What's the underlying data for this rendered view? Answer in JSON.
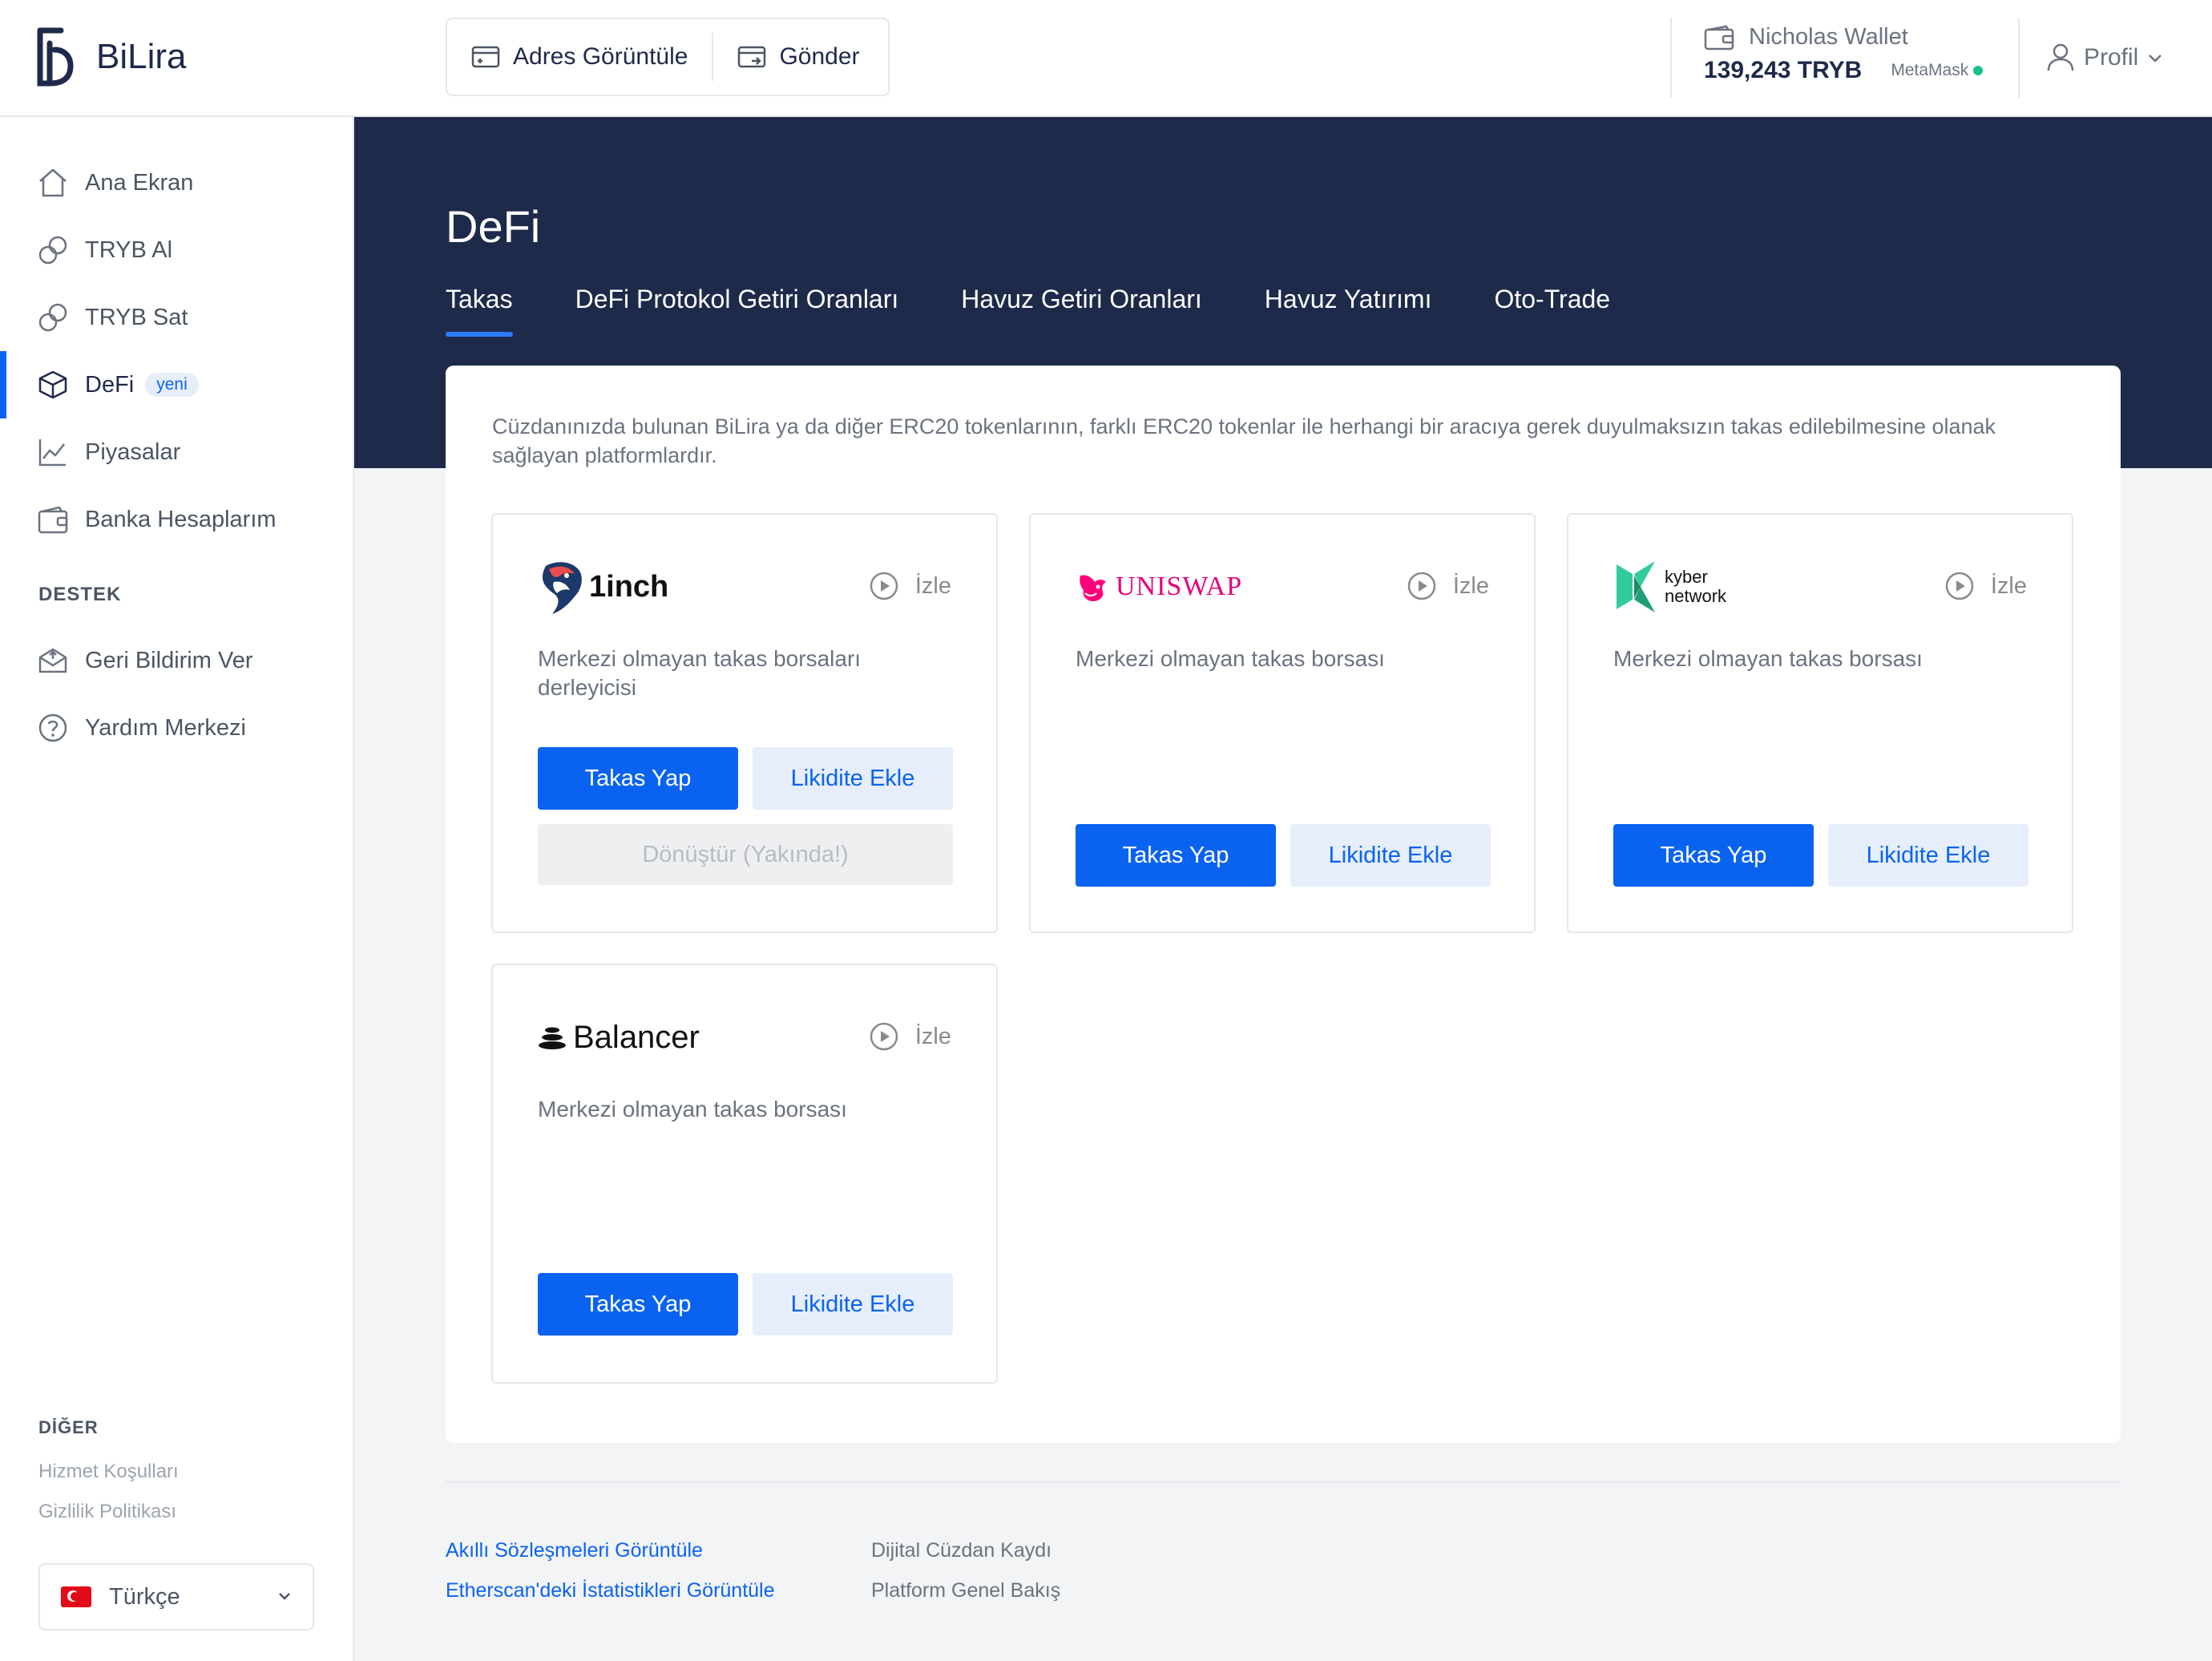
{
  "brand": {
    "name": "BiLira"
  },
  "header": {
    "view_address": "Adres Görüntüle",
    "send": "Gönder",
    "wallet_name": "Nicholas Wallet",
    "wallet_balance": "139,243 TRYB",
    "wallet_provider": "MetaMask",
    "profile": "Profil"
  },
  "sidebar": {
    "items": [
      {
        "label": "Ana Ekran",
        "icon": "home-icon"
      },
      {
        "label": "TRYB Al",
        "icon": "exchange-icon"
      },
      {
        "label": "TRYB Sat",
        "icon": "exchange-icon"
      },
      {
        "label": "DeFi",
        "icon": "cube-icon",
        "badge": "yeni",
        "active": true
      },
      {
        "label": "Piyasalar",
        "icon": "chart-icon"
      },
      {
        "label": "Banka Hesaplarım",
        "icon": "wallet-icon"
      }
    ],
    "support_title": "DESTEK",
    "support_items": [
      {
        "label": "Geri Bildirim Ver",
        "icon": "feedback-icon"
      },
      {
        "label": "Yardım Merkezi",
        "icon": "help-icon"
      }
    ],
    "other_title": "DİĞER",
    "other_links": [
      "Hizmet Koşulları",
      "Gizlilik Politikası"
    ],
    "language": "Türkçe"
  },
  "page": {
    "title": "DeFi",
    "tabs": [
      "Takas",
      "DeFi Protokol Getiri Oranları",
      "Havuz Getiri Oranları",
      "Havuz Yatırımı",
      "Oto-Trade"
    ],
    "active_tab": "Takas",
    "intro": "Cüzdanınızda bulunan BiLira ya da diğer ERC20 tokenlarının, farklı ERC20 tokenlar ile herhangi bir aracıya gerek duyulmaksızın takas edilebilmesine olanak sağlayan platformlardır."
  },
  "cards": [
    {
      "name": "1inch",
      "watch": "İzle",
      "desc": "Merkezi olmayan takas borsaları derleyicisi",
      "swap": "Takas Yap",
      "liquidity": "Likidite Ekle",
      "convert": "Dönüştür (Yakında!)"
    },
    {
      "name": "UNISWAP",
      "watch": "İzle",
      "desc": "Merkezi olmayan takas borsası",
      "swap": "Takas Yap",
      "liquidity": "Likidite Ekle"
    },
    {
      "name_line1": "kyber",
      "name_line2": "network",
      "watch": "İzle",
      "desc": "Merkezi olmayan takas borsası",
      "swap": "Takas Yap",
      "liquidity": "Likidite Ekle"
    },
    {
      "name": "Balancer",
      "watch": "İzle",
      "desc": "Merkezi olmayan takas borsası",
      "swap": "Takas Yap",
      "liquidity": "Likidite Ekle"
    }
  ],
  "footer": {
    "links": [
      "Akıllı Sözleşmeleri Görüntüle",
      "Etherscan'deki İstatistikleri Görüntüle"
    ],
    "muted": [
      "Dijital Cüzdan Kaydı",
      "Platform Genel Bakış"
    ]
  },
  "colors": {
    "navy": "#1e2a4a",
    "accent": "#0a63f0",
    "light_accent": "#e6eefc",
    "status_green": "#18c08f"
  }
}
